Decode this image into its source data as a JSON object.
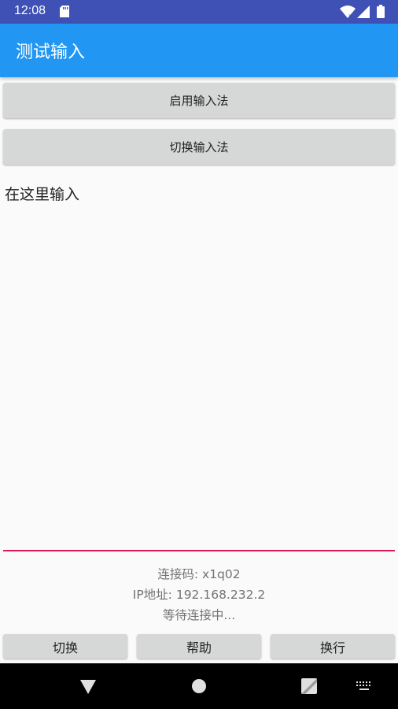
{
  "status_bar": {
    "time": "12:08",
    "icons": [
      "sd-card-icon",
      "wifi-icon",
      "cell-signal-icon",
      "battery-icon"
    ]
  },
  "app_bar": {
    "title": "测试输入",
    "color": "#2196f3"
  },
  "buttons": {
    "enable_ime": "启用输入法",
    "switch_ime": "切换输入法"
  },
  "input": {
    "placeholder": "在这里输入",
    "value": "",
    "underline_color": "#d81b60"
  },
  "info": {
    "connect_code": "连接码: x1q02",
    "ip_address": "IP地址: 192.168.232.2",
    "status": "等待连接中..."
  },
  "bottom_buttons": {
    "toggle": "切换",
    "help": "帮助",
    "newline": "换行"
  },
  "nav_bar": {
    "icons": [
      "back-icon",
      "home-icon",
      "recent-apps-icon",
      "keyboard-icon"
    ]
  },
  "colors": {
    "status_bar": "#3f51b5",
    "app_bar": "#2196f3",
    "accent": "#d81b60"
  }
}
